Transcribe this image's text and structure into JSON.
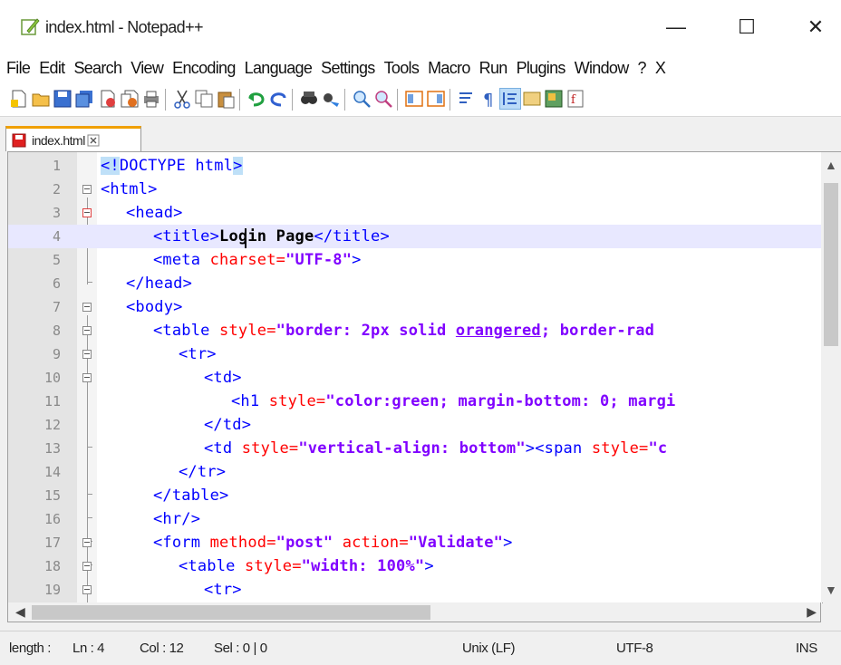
{
  "window": {
    "title": "index.html - Notepad++",
    "minimize_glyph": "—",
    "maximize_glyph": "☐",
    "close_glyph": "✕"
  },
  "menu": [
    "File",
    "Edit",
    "Search",
    "View",
    "Encoding",
    "Language",
    "Settings",
    "Tools",
    "Macro",
    "Run",
    "Plugins",
    "Window",
    "?",
    "X"
  ],
  "tab": {
    "label": "index.html"
  },
  "editor": {
    "line_numbers": [
      "1",
      "2",
      "3",
      "4",
      "5",
      "6",
      "7",
      "8",
      "9",
      "10",
      "11",
      "12",
      "13",
      "14",
      "15",
      "16",
      "17",
      "18",
      "19"
    ],
    "current_line": 4,
    "lines": {
      "l1": [
        "<!",
        "DOCTYPE html",
        ">"
      ],
      "l2": [
        "<html>"
      ],
      "l3": [
        "<head>"
      ],
      "l4": [
        "<title>",
        "Login Page",
        "</title>"
      ],
      "l5": [
        "<meta",
        " charset=",
        "\"UTF-8\"",
        ">"
      ],
      "l6": [
        "</head>"
      ],
      "l7": [
        "<body>"
      ],
      "l8": [
        "<table",
        " style=",
        "\"border: 2px solid ",
        "orangered",
        "; border-rad"
      ],
      "l9": [
        "<tr>"
      ],
      "l10": [
        "<td>"
      ],
      "l11": [
        "<h1",
        " style=",
        "\"color:green; margin-bottom: 0; margi"
      ],
      "l12": [
        "</td>"
      ],
      "l13": [
        "<td",
        " style=",
        "\"vertical-align: bottom\"",
        "><span",
        " style=",
        "\"c"
      ],
      "l14": [
        "</tr>"
      ],
      "l15": [
        "</table>"
      ],
      "l16": [
        "<hr/>"
      ],
      "l17": [
        "<form",
        " method=",
        "\"post\"",
        " action=",
        "\"Validate\"",
        ">"
      ],
      "l18": [
        "<table",
        " style=",
        "\"width: 100%\"",
        ">"
      ],
      "l19": [
        "<tr>"
      ]
    }
  },
  "status": {
    "length": "length :",
    "ln": "Ln : 4",
    "col": "Col : 12",
    "sel": "Sel : 0 | 0",
    "eol": "Unix (LF)",
    "encoding": "UTF-8",
    "mode": "INS"
  },
  "colors": {
    "tag": "#0000ff",
    "attribute": "#ff0000",
    "string": "#8000ff",
    "current_line": "#e8e8ff",
    "tab_accent": "#f0a000"
  }
}
